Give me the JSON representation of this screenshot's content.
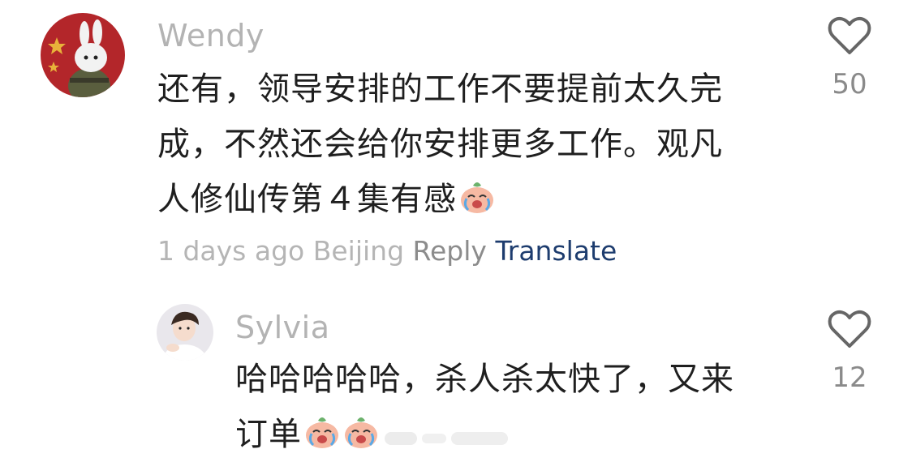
{
  "comments": [
    {
      "author": "Wendy",
      "text": "还有，领导安排的工作不要提前太久完成，不然还会给你安排更多工作。观凡人修仙传第４集有感",
      "text_lines": [
        "还有，领导安排的工作不要提前太久完",
        "成，不然还会给你安排更多工作。观凡",
        "人修仙传第４集有感"
      ],
      "emoji": "crying-peach-emoji",
      "meta": {
        "time": "1 days ago",
        "location": "Beijing",
        "reply": "Reply",
        "translate": "Translate"
      },
      "likes": "50"
    },
    {
      "author": "Sylvia",
      "text_lines": [
        "哈哈哈哈哈，杀人杀太快了，又来",
        "订单"
      ],
      "emoji": "crying-peach-emoji",
      "likes": "12"
    }
  ],
  "colors": {
    "author": "#b3b3b3",
    "meta": "#b5b5b5",
    "reply": "#8c8c8c",
    "translate": "#1d3c6e",
    "like_count": "#8a8a8a"
  }
}
